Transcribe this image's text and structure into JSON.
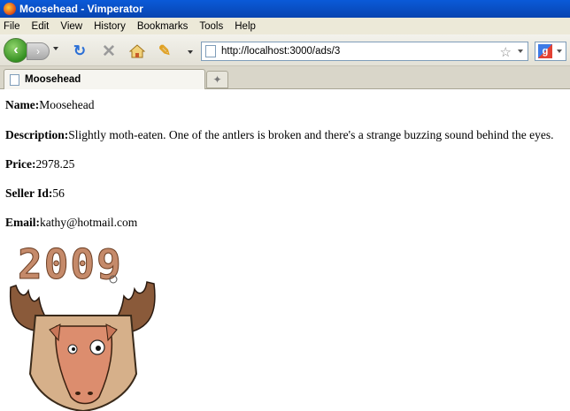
{
  "window": {
    "title": "Moosehead - Vimperator"
  },
  "menubar": {
    "items": [
      "File",
      "Edit",
      "View",
      "History",
      "Bookmarks",
      "Tools",
      "Help"
    ]
  },
  "navbar": {
    "url": "http://localhost:3000/ads/3"
  },
  "tabs": [
    {
      "label": "Moosehead"
    }
  ],
  "ad": {
    "name_label": "Name:",
    "name_value": "Moosehead",
    "description_label": "Description:",
    "description_value": "Slightly moth-eaten. One of the antlers is broken and there's a strange buzzing sound behind the eyes.",
    "price_label": "Price:",
    "price_value": "2978.25",
    "seller_label": "Seller Id:",
    "seller_value": "56",
    "email_label": "Email:",
    "email_value": "kathy@hotmail.com",
    "image_text": "2009"
  },
  "colors": {
    "titlebar": "#0a5ad8",
    "menubar": "#ece9d8",
    "antler": "#8a5a3a",
    "face": "#dc8d6e"
  },
  "icons": [
    "firefox-icon",
    "back-icon",
    "forward-icon",
    "reload-icon",
    "stop-icon",
    "home-icon",
    "pencil-icon",
    "page-icon",
    "bookmark-star-icon",
    "google-icon",
    "new-tab-icon"
  ]
}
